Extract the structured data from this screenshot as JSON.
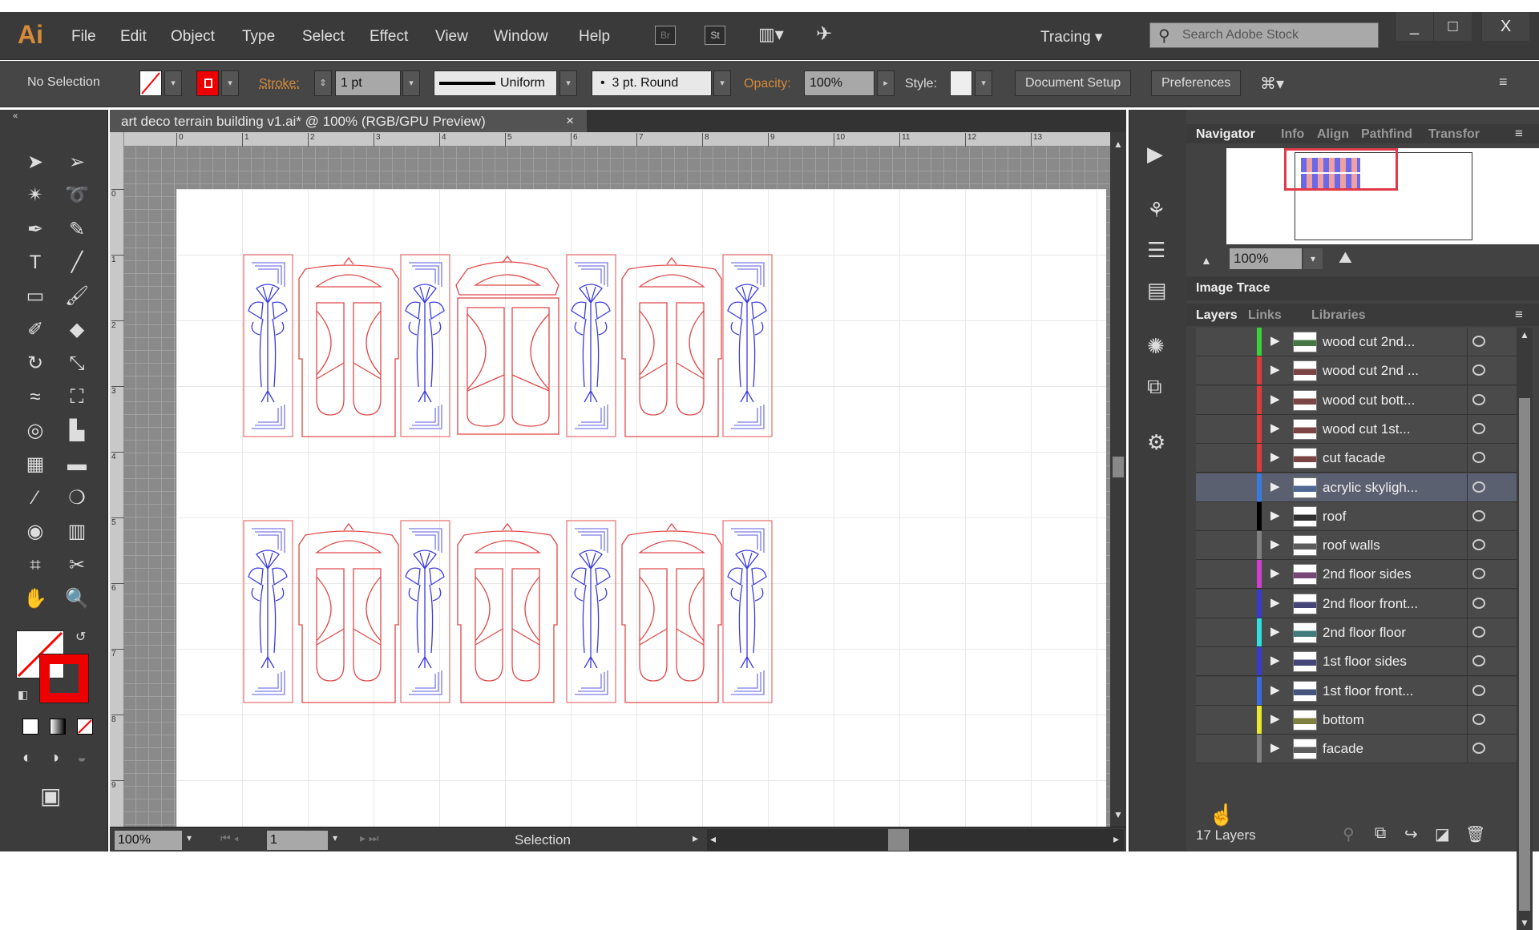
{
  "app": {
    "logo": "Ai",
    "menus": [
      "File",
      "Edit",
      "Object",
      "Type",
      "Select",
      "Effect",
      "View",
      "Window",
      "Help"
    ],
    "bridge": "Br",
    "stock": "St",
    "workspace": "Tracing",
    "search_placeholder": "Search Adobe Stock",
    "window_buttons": [
      "_",
      "□",
      "X"
    ]
  },
  "control": {
    "selection": "No Selection",
    "stroke_label": "Stroke:",
    "stroke_value": "1 pt",
    "profile": "Uniform",
    "brush": "3 pt. Round",
    "opacity_label": "Opacity:",
    "opacity_value": "100%",
    "style_label": "Style:",
    "document_setup": "Document Setup",
    "preferences": "Preferences",
    "accent": "#d48a3a"
  },
  "document": {
    "tab_title": "art deco terrain building v1.ai* @ 100% (RGB/GPU Preview)",
    "close": "×",
    "ruler_h": [
      "0",
      "1",
      "2",
      "3",
      "4",
      "5",
      "6",
      "7",
      "8",
      "9",
      "10",
      "11",
      "12",
      "13"
    ],
    "ruler_v": [
      "0",
      "1",
      "2",
      "3",
      "4",
      "5",
      "6",
      "7",
      "8",
      "9"
    ]
  },
  "status": {
    "zoom": "100%",
    "artboard": "1",
    "tool": "Selection"
  },
  "navigator": {
    "tabs": [
      "Navigator",
      "Info",
      "Align",
      "Pathfind",
      "Transfor"
    ],
    "zoom": "100%"
  },
  "image_trace": {
    "title": "Image Trace"
  },
  "layers": {
    "tabs": [
      "Layers",
      "Links",
      "Libraries"
    ],
    "count": "17 Layers",
    "items": [
      {
        "name": "wood cut 2nd...",
        "color": "#3ad13a"
      },
      {
        "name": "wood cut 2nd ...",
        "color": "#e03a3a"
      },
      {
        "name": "wood cut bott...",
        "color": "#e03a3a"
      },
      {
        "name": "wood cut 1st...",
        "color": "#e03a3a"
      },
      {
        "name": "cut facade",
        "color": "#e03a3a"
      },
      {
        "name": "acrylic skyligh...",
        "color": "#3a7ae0",
        "selected": true
      },
      {
        "name": "roof",
        "color": "#000000"
      },
      {
        "name": "roof walls",
        "color": "#808080"
      },
      {
        "name": "2nd floor sides",
        "color": "#d040d0"
      },
      {
        "name": "2nd floor front...",
        "color": "#3a3ad0"
      },
      {
        "name": "2nd floor floor",
        "color": "#30e0e0"
      },
      {
        "name": "1st floor sides",
        "color": "#3a3ad0"
      },
      {
        "name": "1st floor front...",
        "color": "#3a6ae0"
      },
      {
        "name": "bottom",
        "color": "#e8e830"
      },
      {
        "name": "facade",
        "color": "#808080"
      }
    ]
  }
}
